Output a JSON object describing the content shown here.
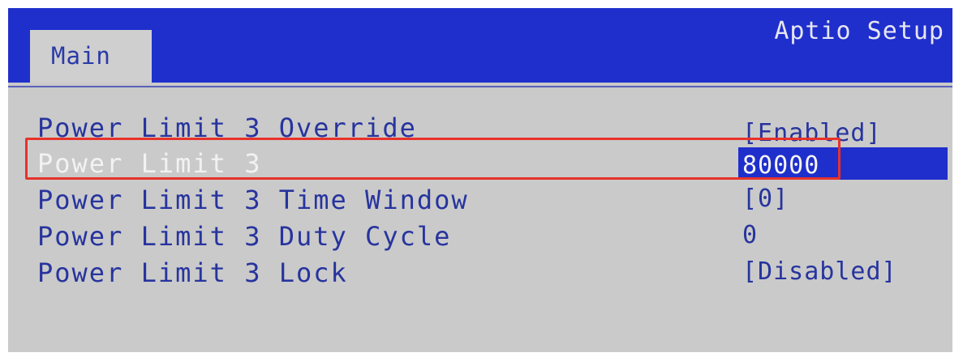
{
  "header": {
    "app_title": "Aptio Setup",
    "tabs": [
      {
        "label": "Main",
        "selected": true
      }
    ]
  },
  "settings": [
    {
      "name": "Power Limit 3 Override",
      "value": "[Enabled]"
    },
    {
      "name": "Power Limit 3",
      "value": "80000",
      "selected": true
    },
    {
      "name": "Power Limit 3 Time Window",
      "value": "[0]"
    },
    {
      "name": "Power Limit 3 Duty Cycle",
      "value": "0"
    },
    {
      "name": "Power Limit 3 Lock",
      "value": "[Disabled]"
    }
  ],
  "colors": {
    "header_blue": "#1f2fcc",
    "text_blue": "#27349e",
    "background_gray": "#cacaca",
    "highlight_red": "#e8322a"
  }
}
